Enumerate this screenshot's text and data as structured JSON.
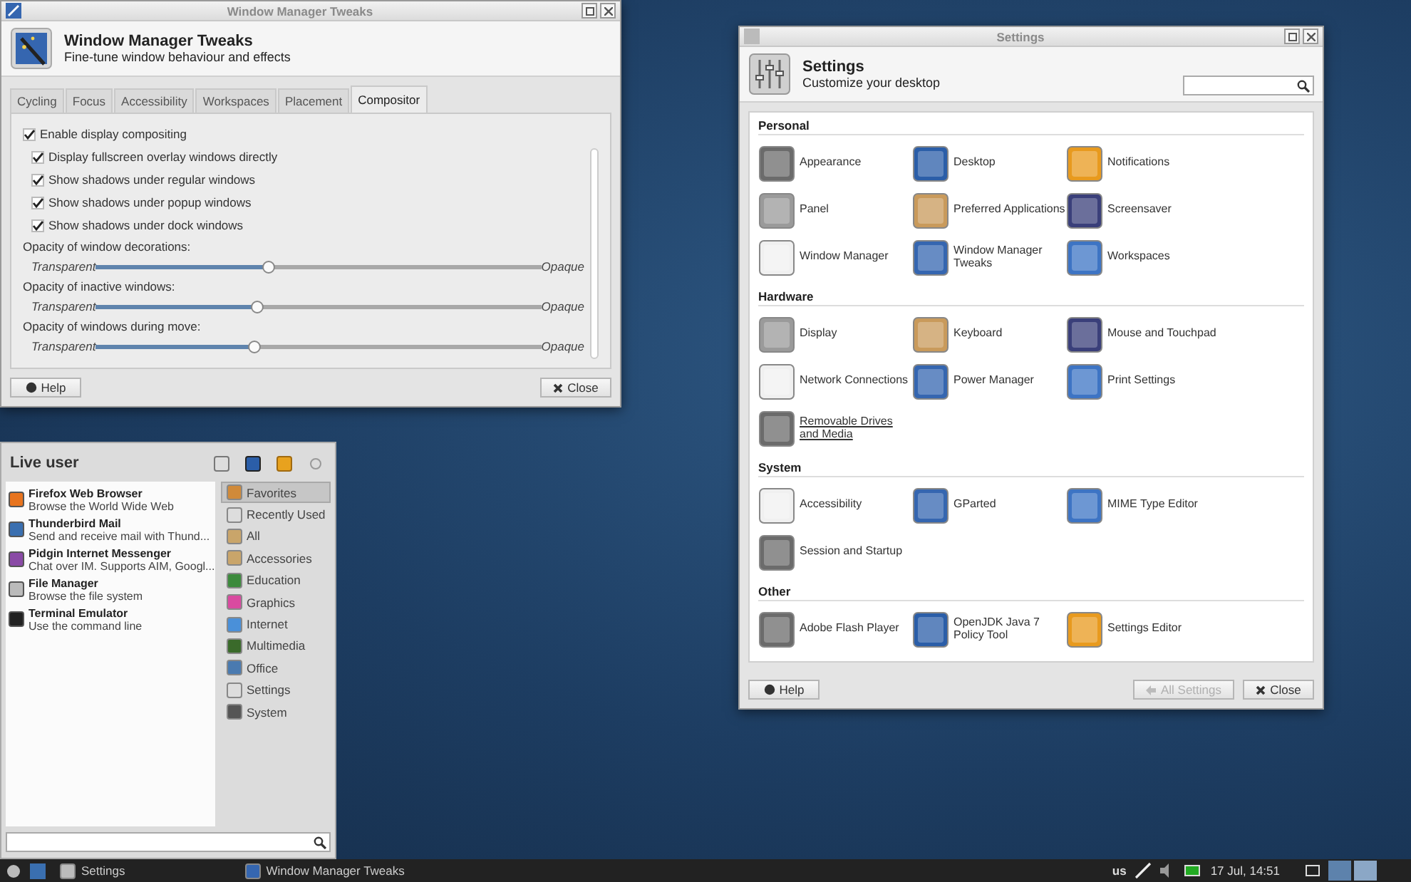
{
  "tweaks_window": {
    "title": "Window Manager Tweaks",
    "heading": "Window Manager Tweaks",
    "subtitle": "Fine-tune window behaviour and effects",
    "tabs": [
      {
        "label": "Cycling",
        "selected": false
      },
      {
        "label": "Focus",
        "selected": false
      },
      {
        "label": "Accessibility",
        "selected": false
      },
      {
        "label": "Workspaces",
        "selected": false
      },
      {
        "label": "Placement",
        "selected": false
      },
      {
        "label": "Compositor",
        "selected": true
      }
    ],
    "options": [
      {
        "label": "Enable display compositing",
        "checked": true,
        "children": [
          {
            "label": "Display fullscreen overlay windows directly",
            "checked": true
          },
          {
            "label": "Show shadows under regular windows",
            "checked": true
          },
          {
            "label": "Show shadows under popup windows",
            "checked": true
          },
          {
            "label": "Show shadows under dock windows",
            "checked": true
          }
        ]
      }
    ],
    "sliders": [
      {
        "label": "Opacity of window decorations:",
        "min_label": "Transparent",
        "max_label": "Opaque",
        "level": 0.385
      },
      {
        "label": "Opacity of inactive windows:",
        "min_label": "Transparent",
        "max_label": "Opaque",
        "level": 0.36
      },
      {
        "label": "Opacity of windows during move:",
        "min_label": "Transparent",
        "max_label": "Opaque",
        "level": 0.355
      }
    ],
    "buttons": {
      "help": "Help",
      "close": "Close"
    }
  },
  "app_menu": {
    "user": "Live user",
    "favorites": [
      {
        "title": "Firefox Web Browser",
        "description": "Browse the World Wide Web"
      },
      {
        "title": "Thunderbird Mail",
        "description": "Send and receive mail with Thund..."
      },
      {
        "title": "Pidgin Internet Messenger",
        "description": "Chat over IM.  Supports AIM, Googl..."
      },
      {
        "title": "File Manager",
        "description": "Browse the file system"
      },
      {
        "title": "Terminal Emulator",
        "description": "Use the command line"
      }
    ],
    "categories": [
      {
        "label": "Favorites",
        "selected": true
      },
      {
        "label": "Recently Used",
        "selected": false
      },
      {
        "label": "All",
        "selected": false
      },
      {
        "label": "Accessories",
        "selected": false
      },
      {
        "label": "Education",
        "selected": false
      },
      {
        "label": "Graphics",
        "selected": false
      },
      {
        "label": "Internet",
        "selected": false
      },
      {
        "label": "Multimedia",
        "selected": false
      },
      {
        "label": "Office",
        "selected": false
      },
      {
        "label": "Settings",
        "selected": false
      },
      {
        "label": "System",
        "selected": false
      }
    ]
  },
  "settings_window": {
    "title": "Settings",
    "heading": "Settings",
    "subtitle": "Customize your desktop",
    "sections": [
      {
        "title": "Personal",
        "items": [
          {
            "label": "Appearance",
            "hovered": false
          },
          {
            "label": "Desktop",
            "hovered": false
          },
          {
            "label": "Notifications",
            "hovered": false
          },
          {
            "label": "Panel",
            "hovered": false
          },
          {
            "label": "Preferred Applications",
            "hovered": false
          },
          {
            "label": "Screensaver",
            "hovered": false
          },
          {
            "label": "Window Manager",
            "hovered": false
          },
          {
            "label": "Window Manager Tweaks",
            "hovered": false
          },
          {
            "label": "Workspaces",
            "hovered": false
          }
        ]
      },
      {
        "title": "Hardware",
        "items": [
          {
            "label": "Display",
            "hovered": false
          },
          {
            "label": "Keyboard",
            "hovered": false
          },
          {
            "label": "Mouse and Touchpad",
            "hovered": false
          },
          {
            "label": "Network Connections",
            "hovered": false
          },
          {
            "label": "Power Manager",
            "hovered": false
          },
          {
            "label": "Print Settings",
            "hovered": false
          },
          {
            "label": "Removable Drives and Media",
            "hovered": true
          }
        ]
      },
      {
        "title": "System",
        "items": [
          {
            "label": "Accessibility",
            "hovered": false
          },
          {
            "label": "GParted",
            "hovered": false
          },
          {
            "label": "MIME Type Editor",
            "hovered": false
          },
          {
            "label": "Session and Startup",
            "hovered": false
          }
        ]
      },
      {
        "title": "Other",
        "items": [
          {
            "label": "Adobe Flash Player",
            "hovered": false
          },
          {
            "label": "OpenJDK Java 7 Policy Tool",
            "hovered": false
          },
          {
            "label": "Settings Editor",
            "hovered": false
          }
        ]
      }
    ],
    "buttons": {
      "help": "Help",
      "all_settings": {
        "label": "All Settings",
        "disabled": true
      },
      "close": "Close"
    }
  },
  "taskbar": {
    "tasks": [
      {
        "label": "Settings"
      },
      {
        "label": "Window Manager Tweaks"
      }
    ],
    "keyboard_layout": "us",
    "clock": "17 Jul, 14:51"
  }
}
